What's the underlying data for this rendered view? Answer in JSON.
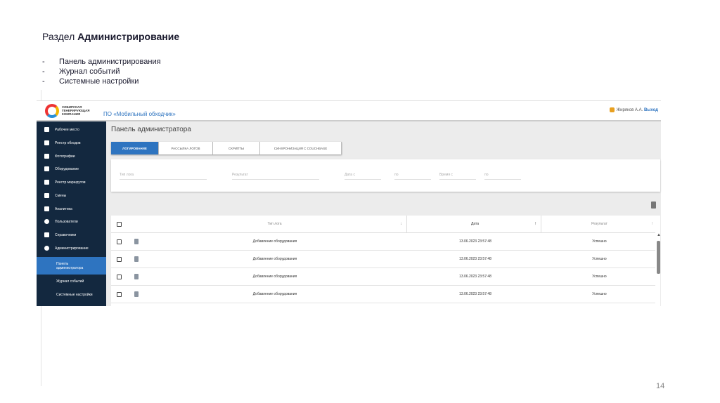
{
  "slide": {
    "title_prefix": "Раздел",
    "title_bold": "Администрирование",
    "bullets": [
      "Панель администрирования",
      "Журнал событий",
      "Системные настройки"
    ],
    "page_number": "14"
  },
  "header": {
    "logo_text": "СИБИРСКАЯ ГЕНЕРИРУЮЩАЯ КОМПАНИЯ",
    "product": "ПО «Мобильный обходчик»",
    "user": "Жиряков А.А.",
    "logout": "Выход"
  },
  "sidebar": {
    "items": [
      "Рабочее место",
      "Реестр обходов",
      "Фотографии",
      "Оборудование",
      "Реестр маршрутов",
      "Смены",
      "Аналитика",
      "Пользователи",
      "Справочники",
      "Администрирование"
    ],
    "sub_items": [
      "Панель администратора",
      "Журнал событий",
      "Системные настройки"
    ]
  },
  "main": {
    "title": "Панель администратора",
    "tabs": [
      "ЛОГИРОВАНИЕ",
      "РАССЫЛКА ЛОГОВ",
      "СКРИПТЫ",
      "СИНХРОНИЗАЦИЯ С COUCHBASE"
    ],
    "filters": [
      "Тип лога",
      "Результат",
      "Дата с",
      "по",
      "Время с",
      "по"
    ],
    "columns": [
      "Тип лога",
      "Дата",
      "Результат"
    ],
    "rows": [
      {
        "type": "Добавление оборудования",
        "date": "13.06.2023 23:57:48",
        "result": "Успешно"
      },
      {
        "type": "Добавление оборудования",
        "date": "13.06.2023 23:57:48",
        "result": "Успешно"
      },
      {
        "type": "Добавление оборудования",
        "date": "13.06.2023 23:57:48",
        "result": "Успешно"
      },
      {
        "type": "Добавление оборудования",
        "date": "13.06.2023 23:57:48",
        "result": "Успешно"
      }
    ]
  },
  "colors": {
    "sidebar": "#13283f",
    "accent": "#2e74c0"
  }
}
